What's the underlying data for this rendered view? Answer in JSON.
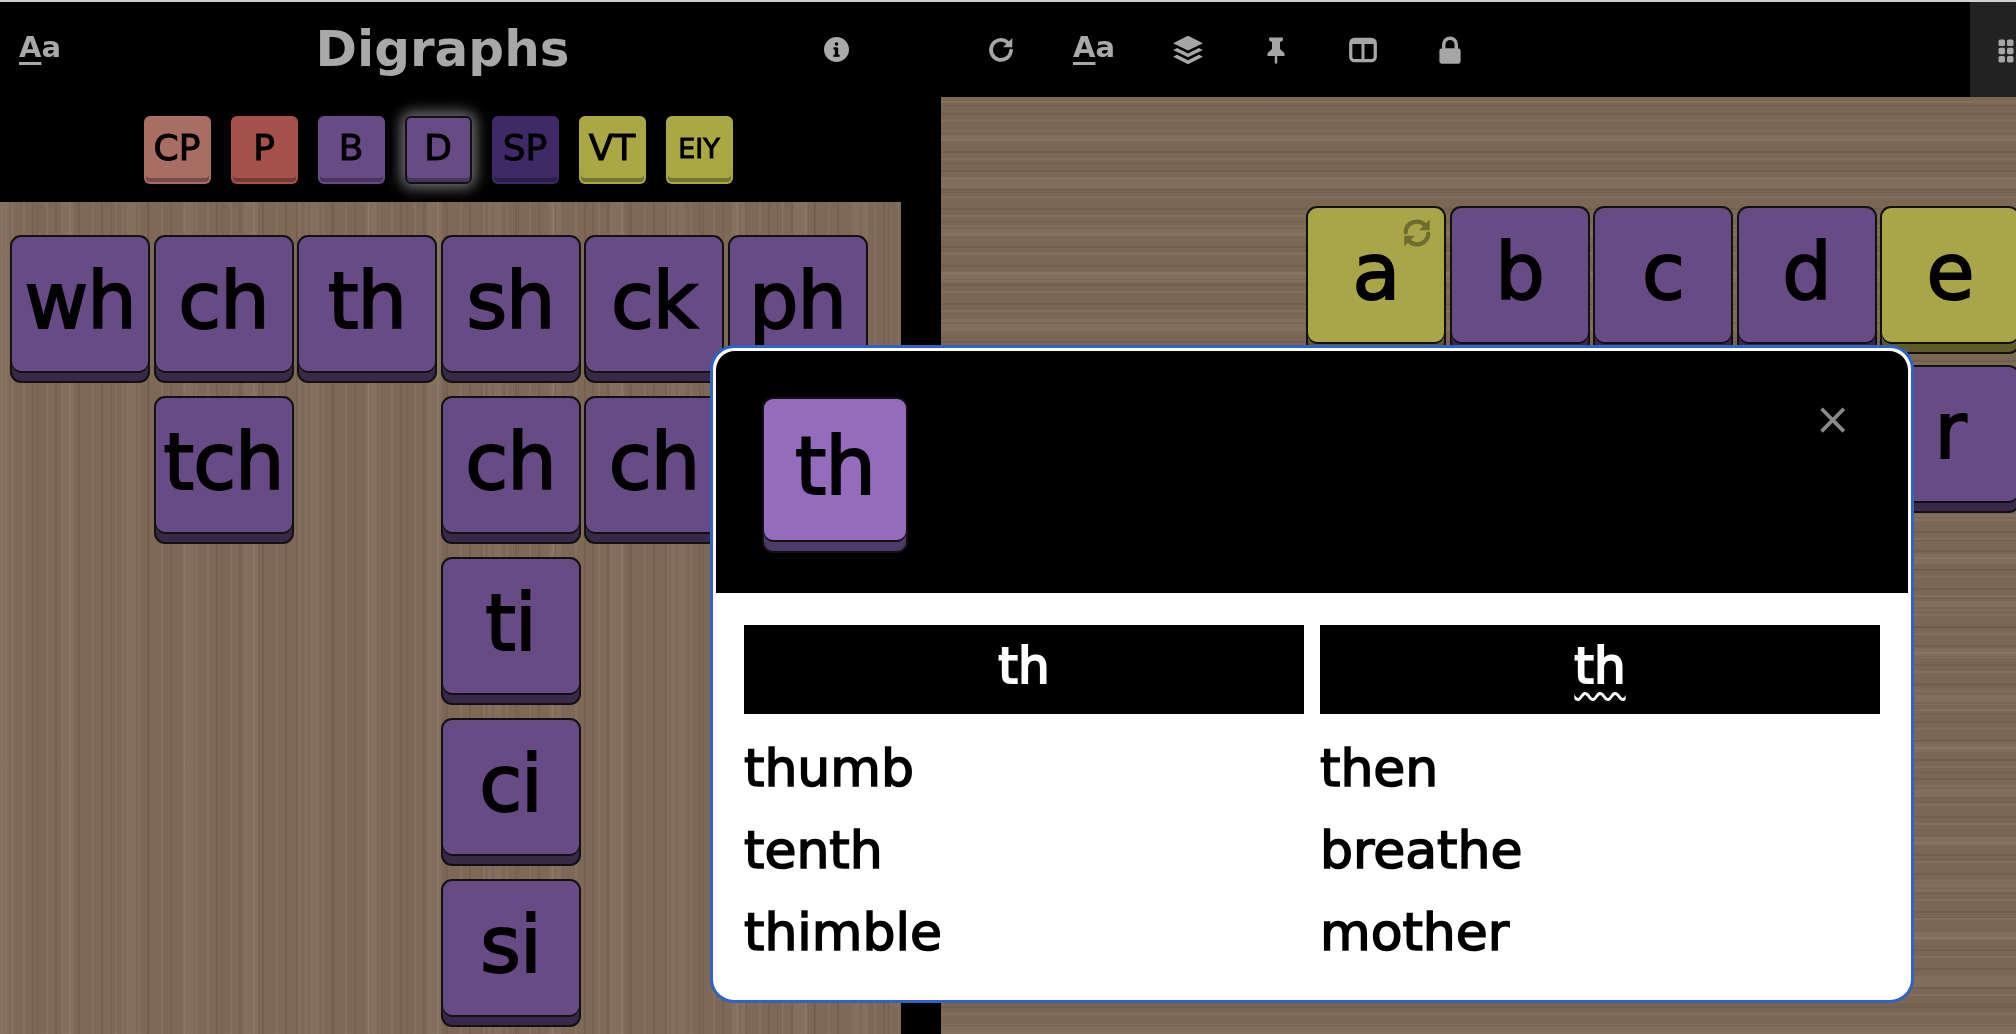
{
  "header": {
    "font_button": "Aa",
    "title": "Digraphs"
  },
  "categories": [
    {
      "label": "CP",
      "color": "#a86e63",
      "selected": false
    },
    {
      "label": "P",
      "color": "#a5534a",
      "selected": false
    },
    {
      "label": "B",
      "color": "#674b85",
      "selected": false
    },
    {
      "label": "D",
      "color": "#674b85",
      "selected": true
    },
    {
      "label": "SP",
      "color": "#3f2a67",
      "selected": false
    },
    {
      "label": "VT",
      "color": "#aaa845",
      "selected": false
    },
    {
      "label": "EIY",
      "color": "#aaa845",
      "selected": false
    }
  ],
  "digraph_board": {
    "tiles": [
      {
        "text": "wh",
        "color": "#674b85"
      },
      {
        "text": "ch",
        "color": "#674b85",
        "alternates": [
          {
            "text": "tch",
            "color": "#674b85"
          }
        ]
      },
      {
        "text": "th",
        "color": "#674b85"
      },
      {
        "text": "sh",
        "color": "#674b85",
        "alternates": [
          {
            "text": "ch",
            "color": "#674b85"
          },
          {
            "text": "ti",
            "color": "#674b85"
          },
          {
            "text": "ci",
            "color": "#674b85"
          },
          {
            "text": "si",
            "color": "#674b85"
          }
        ]
      },
      {
        "text": "ck",
        "color": "#674b85",
        "alternates": [
          {
            "text": "ch",
            "color": "#674b85"
          }
        ]
      },
      {
        "text": "ph",
        "color": "#674b85"
      }
    ]
  },
  "toolbar": {
    "font_button": "Aa"
  },
  "letter_board": {
    "columns": [
      [
        {
          "text": "a",
          "color": "#a9a648",
          "cycle": true
        }
      ],
      [
        {
          "text": "b",
          "color": "#674b85",
          "cycle": false
        }
      ],
      [
        {
          "text": "c",
          "color": "#674b85",
          "cycle": false
        }
      ],
      [
        {
          "text": "d",
          "color": "#674b85",
          "cycle": false
        }
      ],
      [
        {
          "text": "e",
          "color": "#a9a648",
          "cycle": false
        },
        {
          "text": "r",
          "color": "#674b85",
          "cycle": false
        }
      ]
    ]
  },
  "dialog": {
    "tile": "th",
    "close": "×",
    "columns": [
      {
        "heading": "th",
        "wavy_underline": false,
        "words": [
          "thumb",
          "tenth",
          "thimble"
        ]
      },
      {
        "heading": "th",
        "wavy_underline": true,
        "words": [
          "then",
          "breathe",
          "mother"
        ]
      }
    ]
  }
}
